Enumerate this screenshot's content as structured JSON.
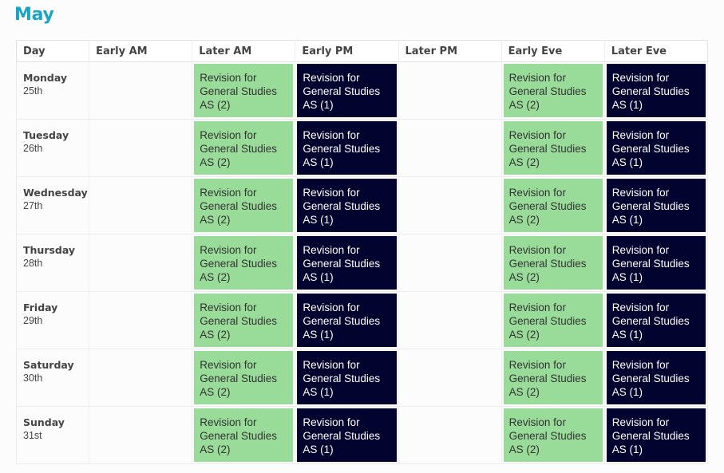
{
  "month": "May",
  "colors": {
    "title": "#1aa3c4",
    "session_green": "#99db99",
    "session_navy": "#03032f"
  },
  "columns": [
    "Day",
    "Early AM",
    "Later AM",
    "Early PM",
    "Later PM",
    "Early Eve",
    "Later Eve"
  ],
  "rows": [
    {
      "day": "Monday",
      "date": "25th",
      "slots": [
        "",
        "Revision for General Studies AS (2)",
        "Revision for General Studies AS (1)",
        "",
        "Revision for General Studies AS (2)",
        "Revision for General Studies AS (1)"
      ]
    },
    {
      "day": "Tuesday",
      "date": "26th",
      "slots": [
        "",
        "Revision for General Studies AS (2)",
        "Revision for General Studies AS (1)",
        "",
        "Revision for General Studies AS (2)",
        "Revision for General Studies AS (1)"
      ]
    },
    {
      "day": "Wednesday",
      "date": "27th",
      "slots": [
        "",
        "Revision for General Studies AS (2)",
        "Revision for General Studies AS (1)",
        "",
        "Revision for General Studies AS (2)",
        "Revision for General Studies AS (1)"
      ]
    },
    {
      "day": "Thursday",
      "date": "28th",
      "slots": [
        "",
        "Revision for General Studies AS (2)",
        "Revision for General Studies AS (1)",
        "",
        "Revision for General Studies AS (2)",
        "Revision for General Studies AS (1)"
      ]
    },
    {
      "day": "Friday",
      "date": "29th",
      "slots": [
        "",
        "Revision for General Studies AS (2)",
        "Revision for General Studies AS (1)",
        "",
        "Revision for General Studies AS (2)",
        "Revision for General Studies AS (1)"
      ]
    },
    {
      "day": "Saturday",
      "date": "30th",
      "slots": [
        "",
        "Revision for General Studies AS (2)",
        "Revision for General Studies AS (1)",
        "",
        "Revision for General Studies AS (2)",
        "Revision for General Studies AS (1)"
      ]
    },
    {
      "day": "Sunday",
      "date": "31st",
      "slots": [
        "",
        "Revision for General Studies AS (2)",
        "Revision for General Studies AS (1)",
        "",
        "Revision for General Studies AS (2)",
        "Revision for General Studies AS (1)"
      ]
    }
  ]
}
